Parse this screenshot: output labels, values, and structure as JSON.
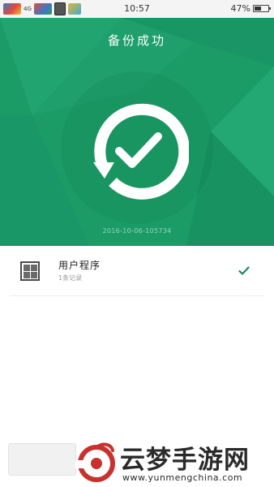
{
  "status_bar": {
    "signal_text": "4G",
    "time": "10:57",
    "battery_text": "47%",
    "battery_level": 0.47
  },
  "hero": {
    "title": "备份成功",
    "timestamp": "2016-10-06-105734",
    "icon": "check-circle-icon",
    "background_color": "#1b9c67"
  },
  "items": [
    {
      "title": "用户程序",
      "subtitle": "1条记录",
      "icon": "app-grid-icon",
      "status_icon": "check-icon",
      "status_color": "#1b8a5a"
    }
  ],
  "bottom": {
    "button_label": ""
  },
  "watermark": {
    "name": "云梦手游网",
    "url": "www.yunmengchina.com",
    "logo_color": "#c8322e"
  }
}
